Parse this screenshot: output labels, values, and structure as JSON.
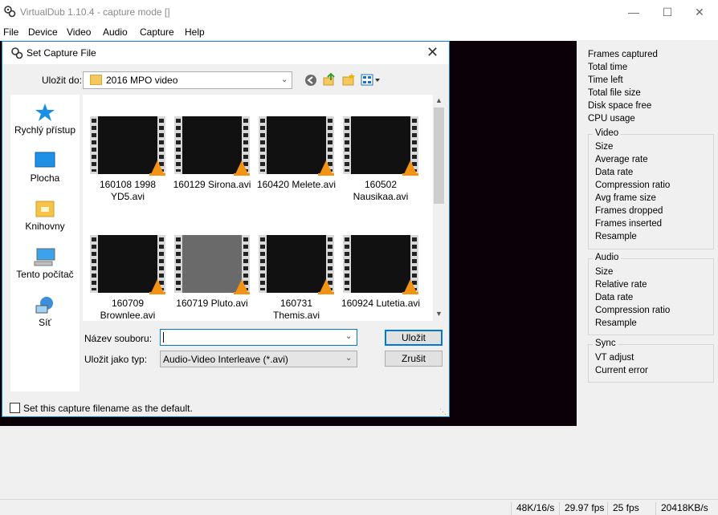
{
  "window": {
    "title": "VirtualDub 1.10.4 - capture mode []",
    "minimize": "—",
    "maximize": "☐",
    "close": "✕"
  },
  "menu": [
    "File",
    "Device",
    "Video",
    "Audio",
    "Capture",
    "Help"
  ],
  "side_panel": {
    "stats": [
      "Frames captured",
      "Total time",
      "Time left",
      "Total file size",
      "Disk space free",
      "CPU usage"
    ],
    "video_group": {
      "title": "Video",
      "items": [
        "Size",
        "Average rate",
        "Data rate",
        "Compression ratio",
        "Avg frame size",
        "Frames dropped",
        "Frames inserted",
        "Resample"
      ]
    },
    "audio_group": {
      "title": "Audio",
      "items": [
        "Size",
        "Relative rate",
        "Data rate",
        "Compression ratio",
        "Resample"
      ]
    },
    "sync_group": {
      "title": "Sync",
      "items": [
        "VT adjust",
        "Current error"
      ]
    }
  },
  "status_bar": [
    "48K/16/s",
    "29.97 fps",
    "25 fps",
    "20418KB/s"
  ],
  "dialog": {
    "title": "Set Capture File",
    "close": "✕",
    "save_in_label": "Uložit do:",
    "save_in_value": "2016 MPO video",
    "places": [
      "Rychlý přístup",
      "Plocha",
      "Knihovny",
      "Tento počítač",
      "Síť"
    ],
    "files": [
      {
        "name": "160108 1998 YD5.avi",
        "thumb": "dark"
      },
      {
        "name": "160129 Sirona.avi",
        "thumb": "dark"
      },
      {
        "name": "160420 Melete.avi",
        "thumb": "dark"
      },
      {
        "name": "160502 Nausikaa.avi",
        "thumb": "dark"
      },
      {
        "name": "160709 Brownlee.avi",
        "thumb": "dark"
      },
      {
        "name": "160719 Pluto.avi",
        "thumb": "grey"
      },
      {
        "name": "160731 Themis.avi",
        "thumb": "dark"
      },
      {
        "name": "160924 Lutetia.avi",
        "thumb": "dark"
      }
    ],
    "filename_label": "Název souboru:",
    "filename_value": "",
    "filetype_label": "Uložit jako typ:",
    "filetype_value": "Audio-Video Interleave (*.avi)",
    "save_button": "Uložit",
    "cancel_button": "Zrušit",
    "default_checkbox_label": "Set this capture filename as the default."
  }
}
